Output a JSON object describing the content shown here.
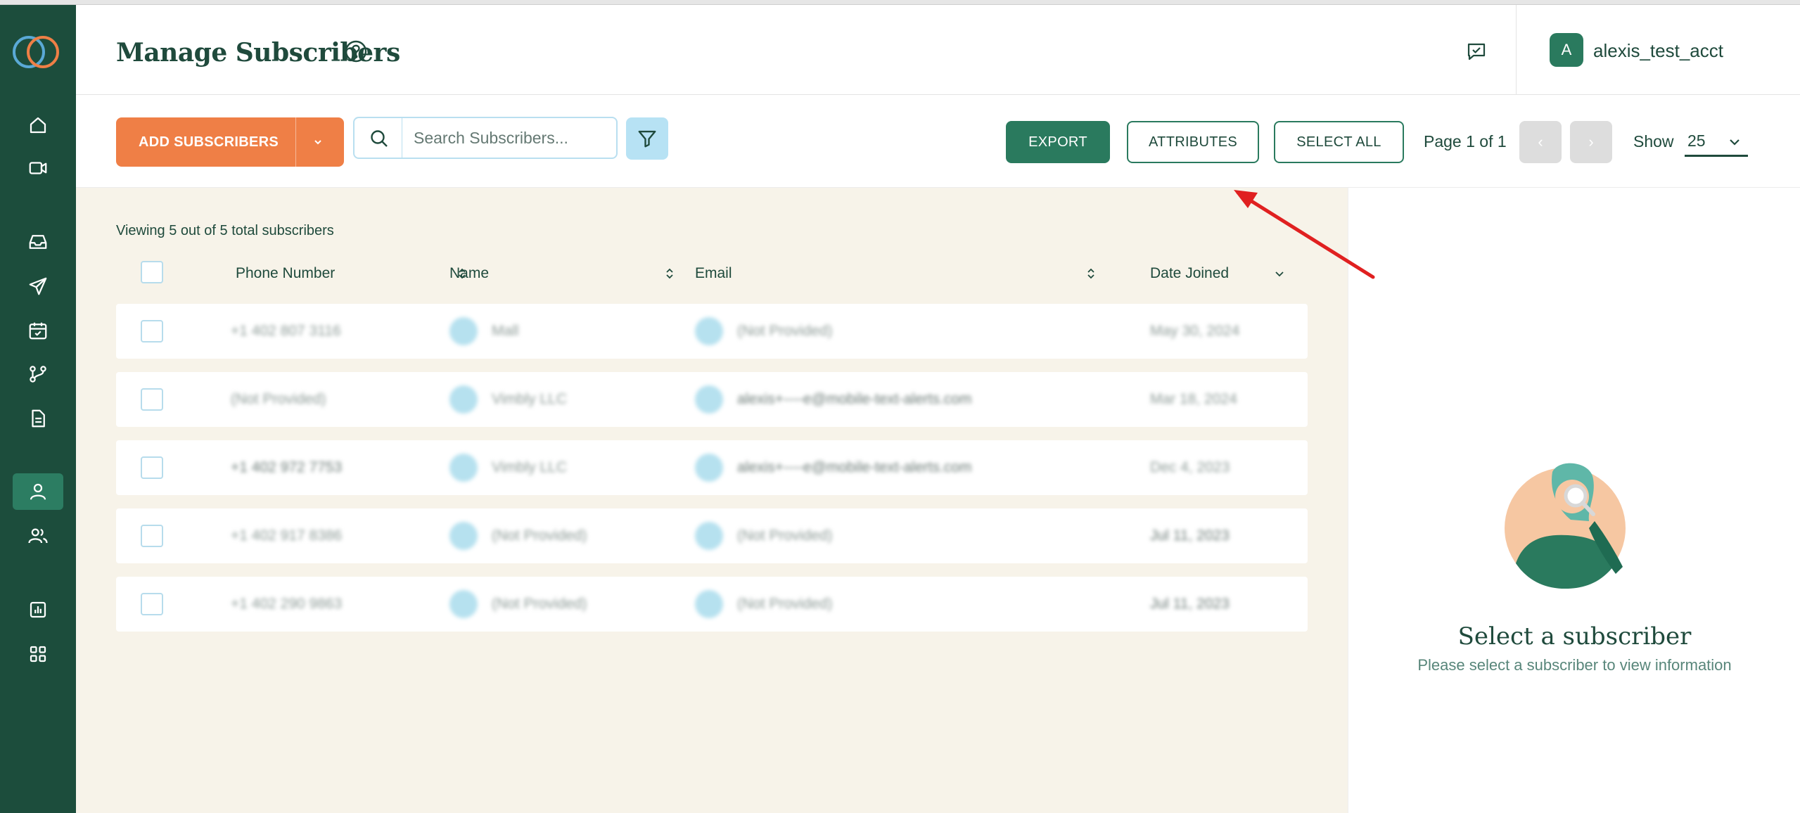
{
  "header": {
    "title": "Manage Subscribers",
    "account": {
      "initial": "A",
      "name": "alexis_test_acct"
    }
  },
  "sidebar": {
    "items": [
      {
        "icon": "home-icon"
      },
      {
        "icon": "video-icon"
      },
      {
        "icon": "inbox-icon"
      },
      {
        "icon": "send-icon"
      },
      {
        "icon": "calendar-icon"
      },
      {
        "icon": "workflow-icon"
      },
      {
        "icon": "document-icon"
      },
      {
        "icon": "user-icon",
        "active": true
      },
      {
        "icon": "users-icon"
      },
      {
        "icon": "chart-icon"
      },
      {
        "icon": "apps-icon"
      }
    ]
  },
  "toolbar": {
    "add_label": "ADD SUBSCRIBERS",
    "search_placeholder": "Search Subscribers...",
    "export_label": "EXPORT",
    "attributes_label": "ATTRIBUTES",
    "select_all_label": "SELECT ALL",
    "page_info": "Page 1 of 1",
    "prev": "‹",
    "next": "›",
    "show_label": "Show",
    "show_value": "25"
  },
  "table": {
    "viewing_text": "Viewing 5 out of 5 total subscribers",
    "columns": [
      "Phone Number",
      "Name",
      "Email",
      "Date Joined"
    ],
    "rows": [
      {
        "phone": "+1 402 807 3116",
        "name": "Mall",
        "email": "(Not Provided)",
        "date": "May 30, 2024"
      },
      {
        "phone": "(Not Provided)",
        "name": "Vimbly LLC",
        "email": "alexis+----e@mobile-text-alerts.com",
        "date": "Mar 18, 2024"
      },
      {
        "phone": "+1 402 972 7753",
        "name": "Vimbly LLC",
        "email": "alexis+----e@mobile-text-alerts.com",
        "date": "Dec 4, 2023"
      },
      {
        "phone": "+1 402 917 8386",
        "name": "(Not Provided)",
        "email": "(Not Provided)",
        "date": "Jul 11, 2023"
      },
      {
        "phone": "+1 402 290 9863",
        "name": "(Not Provided)",
        "email": "(Not Provided)",
        "date": "Jul 11, 2023"
      }
    ]
  },
  "panel": {
    "title": "Select a subscriber",
    "subtitle": "Please select a subscriber to view information"
  },
  "colors": {
    "sidebar": "#1c4d3c",
    "accent_orange": "#ef7f46",
    "primary_green": "#2a7a5e",
    "content_bg": "#f7f3e9",
    "light_blue": "#b7e2f4",
    "annotation_red": "#e02020"
  }
}
